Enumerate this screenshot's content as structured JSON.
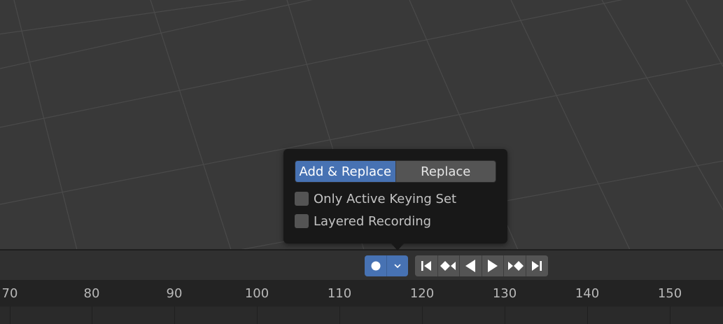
{
  "timeline": {
    "ruler_ticks": [
      "70",
      "80",
      "90",
      "100",
      "110",
      "120",
      "130",
      "140",
      "150"
    ],
    "record_controls": {
      "record_icon": "record-dot-icon",
      "dropdown_icon": "chevron-down-icon"
    },
    "playback_controls": [
      {
        "name": "jump-to-start",
        "icon": "jump-start-icon"
      },
      {
        "name": "jump-to-previous-keyframe",
        "icon": "prev-keyframe-icon"
      },
      {
        "name": "play-reverse",
        "icon": "play-reverse-icon"
      },
      {
        "name": "play",
        "icon": "play-icon"
      },
      {
        "name": "jump-to-next-keyframe",
        "icon": "next-keyframe-icon"
      },
      {
        "name": "jump-to-end",
        "icon": "jump-end-icon"
      }
    ]
  },
  "popover": {
    "mode_options": [
      {
        "label": "Add & Replace",
        "active": true
      },
      {
        "label": "Replace",
        "active": false
      }
    ],
    "checkboxes": [
      {
        "label": "Only Active Keying Set",
        "checked": false
      },
      {
        "label": "Layered Recording",
        "checked": false
      }
    ]
  },
  "colors": {
    "accent": "#4772b3",
    "viewport_bg": "#393939",
    "popover_bg": "#181818",
    "button_bg": "#545454"
  }
}
